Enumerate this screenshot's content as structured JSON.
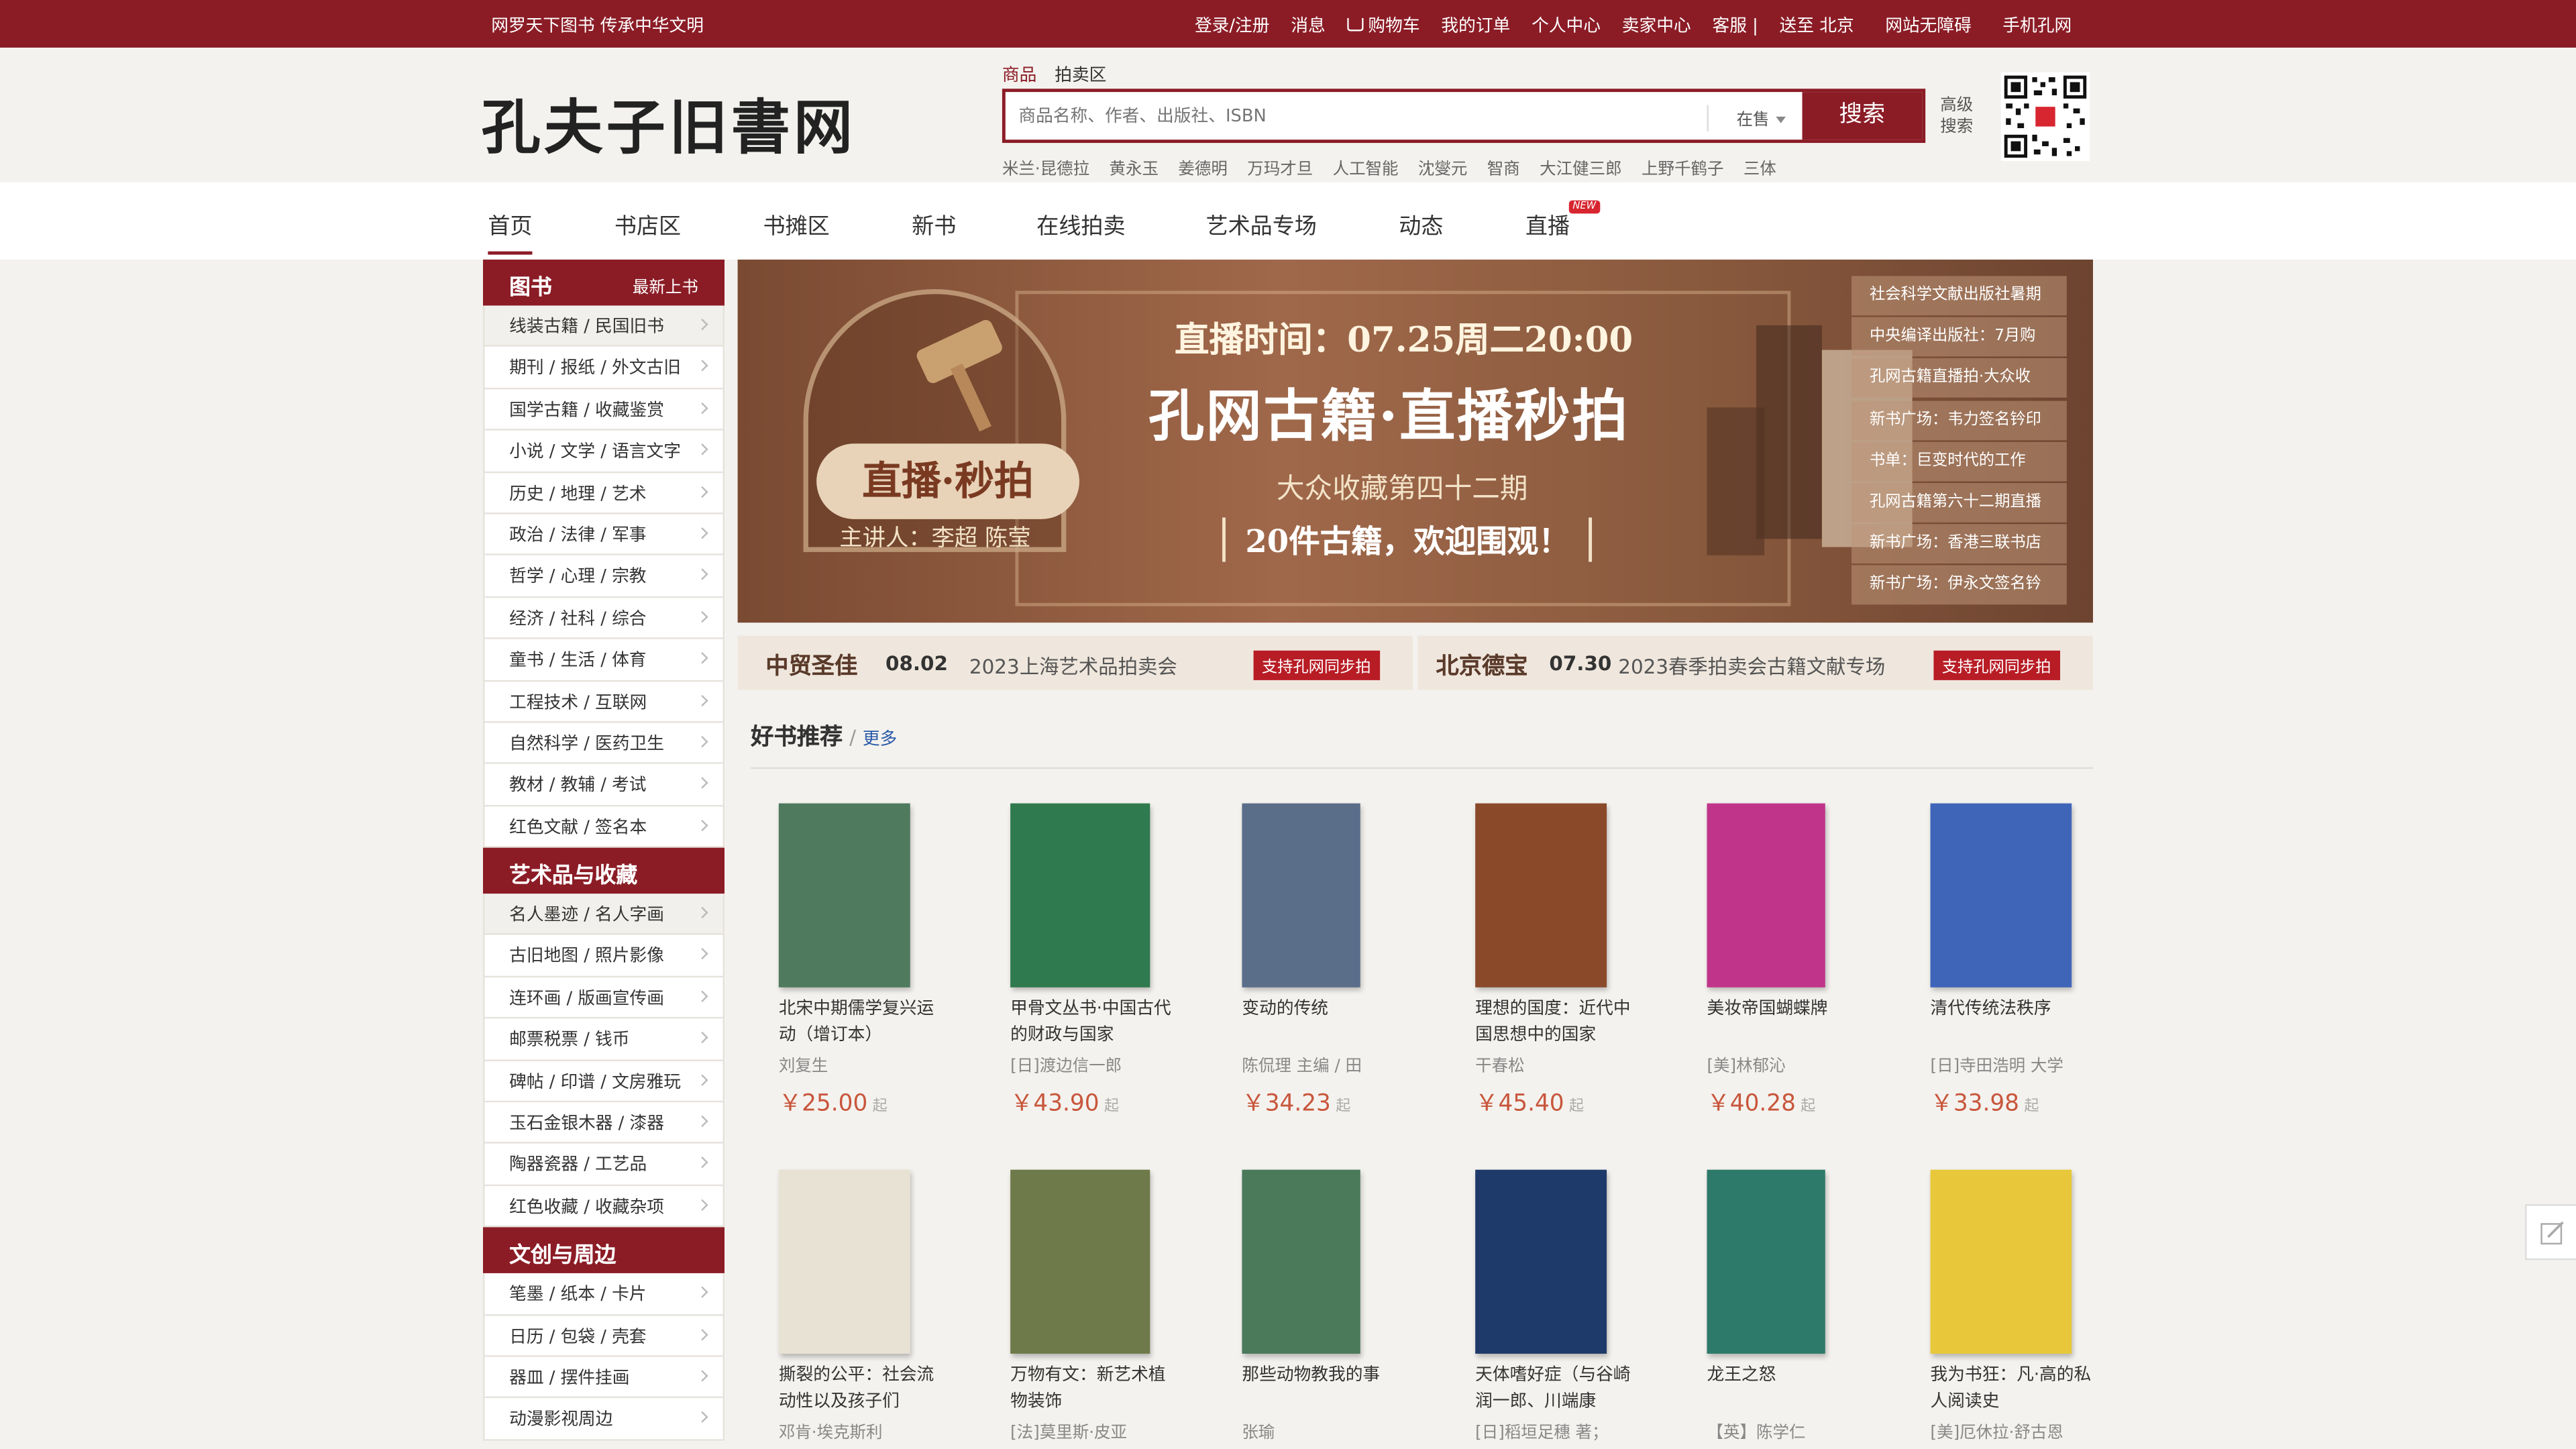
{
  "topbar": {
    "slogan": "网罗天下图书  传承中华文明",
    "links": [
      "登录/注册",
      "消息",
      "购物车",
      "我的订单",
      "个人中心",
      "卖家中心",
      "客服 |",
      "送至 北京",
      "网站无障碍",
      "手机孔网"
    ]
  },
  "header": {
    "logo": "孔夫子旧書网",
    "search_tabs": [
      "商品",
      "拍卖区"
    ],
    "search_placeholder": "商品名称、作者、出版社、ISBN",
    "search_scope": "在售",
    "search_button": "搜索",
    "advanced": "高级搜索",
    "hot_keywords": [
      "米兰·昆德拉",
      "黄永玉",
      "姜德明",
      "万玛才旦",
      "人工智能",
      "沈燮元",
      "智商",
      "大江健三郎",
      "上野千鹤子",
      "三体"
    ]
  },
  "nav": {
    "items": [
      "首页",
      "书店区",
      "书摊区",
      "新书",
      "在线拍卖",
      "艺术品专场",
      "动态",
      "直播"
    ],
    "new_badge": "NEW"
  },
  "sidebar": {
    "sections": [
      {
        "title": "图书",
        "extra": "最新上书",
        "items": [
          "线装古籍 / 民国旧书",
          "期刊 / 报纸 / 外文古旧",
          "国学古籍 / 收藏鉴赏",
          "小说 / 文学 / 语言文字",
          "历史 / 地理 / 艺术",
          "政治 / 法律 / 军事",
          "哲学 / 心理 / 宗教",
          "经济 / 社科 / 综合",
          "童书 / 生活 / 体育",
          "工程技术 / 互联网",
          "自然科学 / 医药卫生",
          "教材 / 教辅 / 考试",
          "红色文献 / 签名本"
        ]
      },
      {
        "title": "艺术品与收藏",
        "extra": "",
        "items": [
          "名人墨迹 / 名人字画",
          "古旧地图 / 照片影像",
          "连环画 / 版画宣传画",
          "邮票税票 / 钱币",
          "碑帖 / 印谱 / 文房雅玩",
          "玉石金银木器 / 漆器",
          "陶器瓷器 / 工艺品",
          "红色收藏 / 收藏杂项"
        ]
      },
      {
        "title": "文创与周边",
        "extra": "",
        "items": [
          "笔墨 / 纸本 / 卡片",
          "日历 / 包袋 / 壳套",
          "器皿 / 摆件挂画",
          "动漫影视周边"
        ]
      }
    ]
  },
  "banner": {
    "time": "直播时间：07.25周二20:00",
    "title": "孔网古籍·直播秒拍",
    "subtitle": "大众收藏第四十二期",
    "cta": "20件古籍，欢迎围观！",
    "tag": "直播·秒拍",
    "host": "主讲人：李超 陈莹",
    "panel": [
      "社会科学文献出版社暑期",
      "中央编译出版社：7月购",
      "孔网古籍直播拍·大众收",
      "新书广场：韦力签名钤印",
      "书单：巨变时代的工作",
      "孔网古籍第六十二期直播",
      "新书广场：香港三联书店",
      "新书广场：伊永文签名钤"
    ]
  },
  "auctions": [
    {
      "name": "中贸圣佳",
      "date": "08.02",
      "desc": "2023上海艺术品拍卖会",
      "badge": "支持孔网同步拍"
    },
    {
      "name": "北京德宝",
      "date": "07.30",
      "desc": "2023春季拍卖会古籍文献专场",
      "badge": "支持孔网同步拍"
    }
  ],
  "recommend": {
    "title": "好书推荐",
    "more": "更多",
    "price_suffix": "起",
    "books": [
      {
        "title": "北宋中期儒学复兴运动（增订本）",
        "author": "刘复生",
        "price": "￥25.00",
        "cover": "#4f7a5e"
      },
      {
        "title": "甲骨文丛书·中国古代的财政与国家",
        "author": "[日]渡边信一郎",
        "price": "￥43.90",
        "cover": "#2f7a4e"
      },
      {
        "title": "变动的传统",
        "author": "陈侃理 主编 / 田",
        "price": "￥34.23",
        "cover": "#5a6e8a"
      },
      {
        "title": "理想的国度：近代中国思想中的国家",
        "author": "干春松",
        "price": "￥45.40",
        "cover": "#8a4a2a"
      },
      {
        "title": "美妆帝国蝴蝶牌",
        "author": "[美]林郁沁",
        "price": "￥40.28",
        "cover": "#c0358a"
      },
      {
        "title": "清代传统法秩序",
        "author": "[日]寺田浩明 大学",
        "price": "￥33.98",
        "cover": "#3f65b8"
      },
      {
        "title": "撕裂的公平：社会流动性以及孩子们",
        "author": "邓肯·埃克斯利",
        "price": "",
        "cover": "#e8e2d4"
      },
      {
        "title": "万物有文：新艺术植物装饰",
        "author": "[法]莫里斯·皮亚",
        "price": "",
        "cover": "#6f7a4a"
      },
      {
        "title": "那些动物教我的事",
        "author": "张瑜",
        "price": "",
        "cover": "#4a7a5a"
      },
      {
        "title": "天体嗜好症（与谷崎润一郎、川端康",
        "author": "[日]稻垣足穗 著；",
        "price": "",
        "cover": "#1e3a6a"
      },
      {
        "title": "龙王之怒",
        "author": "【英】陈学仁",
        "price": "",
        "cover": "#2e7a6a"
      },
      {
        "title": "我为书狂：凡·高的私人阅读史",
        "author": "[美]厄休拉·舒古恩",
        "price": "",
        "cover": "#e8c83a"
      }
    ]
  }
}
